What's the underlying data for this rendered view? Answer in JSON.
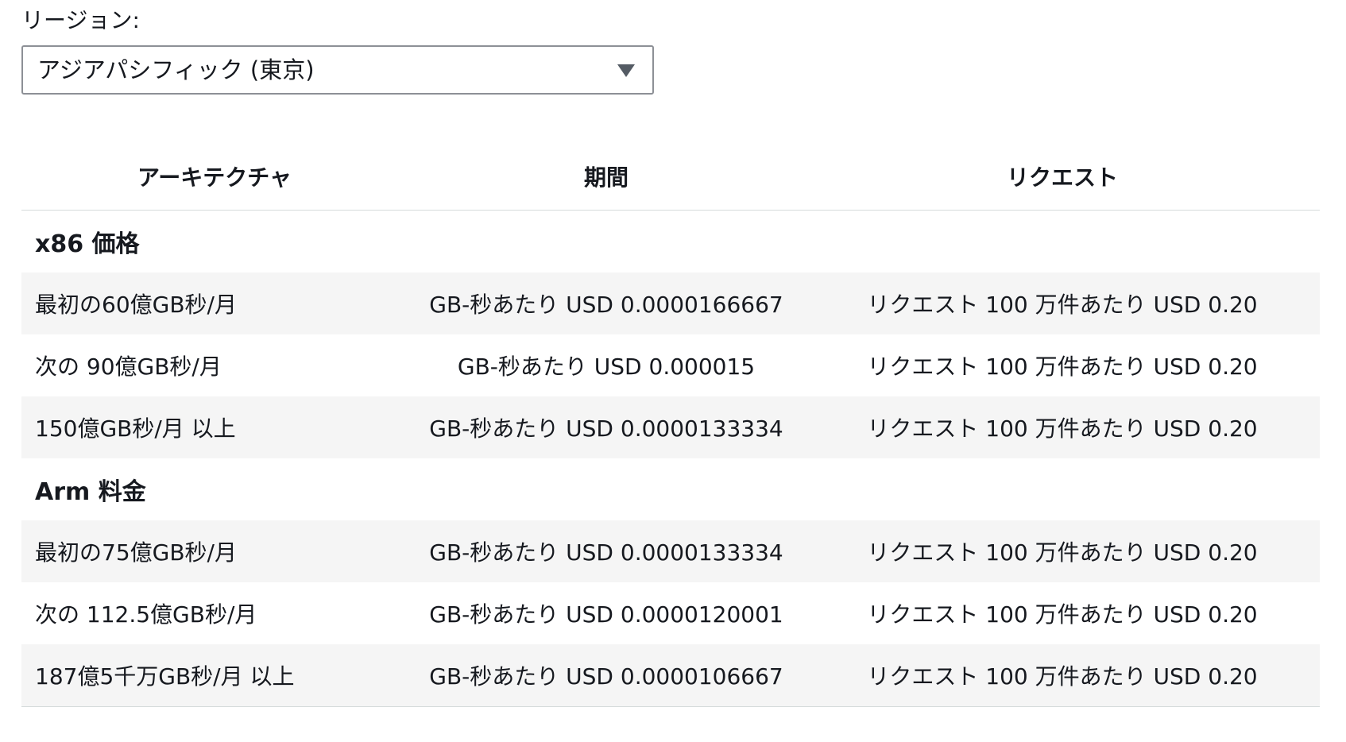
{
  "region": {
    "label": "リージョン:",
    "selected": "アジアパシフィック (東京)",
    "caret_icon": "triangle-down-icon"
  },
  "table": {
    "headers": [
      "アーキテクチャ",
      "期間",
      "リクエスト"
    ],
    "sections": [
      {
        "title": "x86 価格",
        "rows": [
          {
            "tier": "最初の60億GB秒/月",
            "duration": "GB-秒あたり USD 0.0000166667",
            "request": "リクエスト 100 万件あたり USD 0.20"
          },
          {
            "tier": "次の 90億GB秒/月",
            "duration": "GB-秒あたり USD 0.000015",
            "request": "リクエスト 100 万件あたり USD 0.20"
          },
          {
            "tier": "150億GB秒/月 以上",
            "duration": "GB-秒あたり USD 0.0000133334",
            "request": "リクエスト 100 万件あたり USD 0.20"
          }
        ]
      },
      {
        "title": "Arm 料金",
        "rows": [
          {
            "tier": "最初の75億GB秒/月",
            "duration": "GB-秒あたり USD 0.0000133334",
            "request": "リクエスト 100 万件あたり USD 0.20"
          },
          {
            "tier": "次の 112.5億GB秒/月",
            "duration": "GB-秒あたり USD 0.0000120001",
            "request": "リクエスト 100 万件あたり USD 0.20"
          },
          {
            "tier": "187億5千万GB秒/月 以上",
            "duration": "GB-秒あたり USD 0.0000106667",
            "request": "リクエスト 100 万件あたり USD 0.20"
          }
        ]
      }
    ]
  },
  "colors": {
    "text": "#16191f",
    "row_shade": "#f5f5f5",
    "divider": "#d5dbdb",
    "select_border": "#8d9096"
  }
}
